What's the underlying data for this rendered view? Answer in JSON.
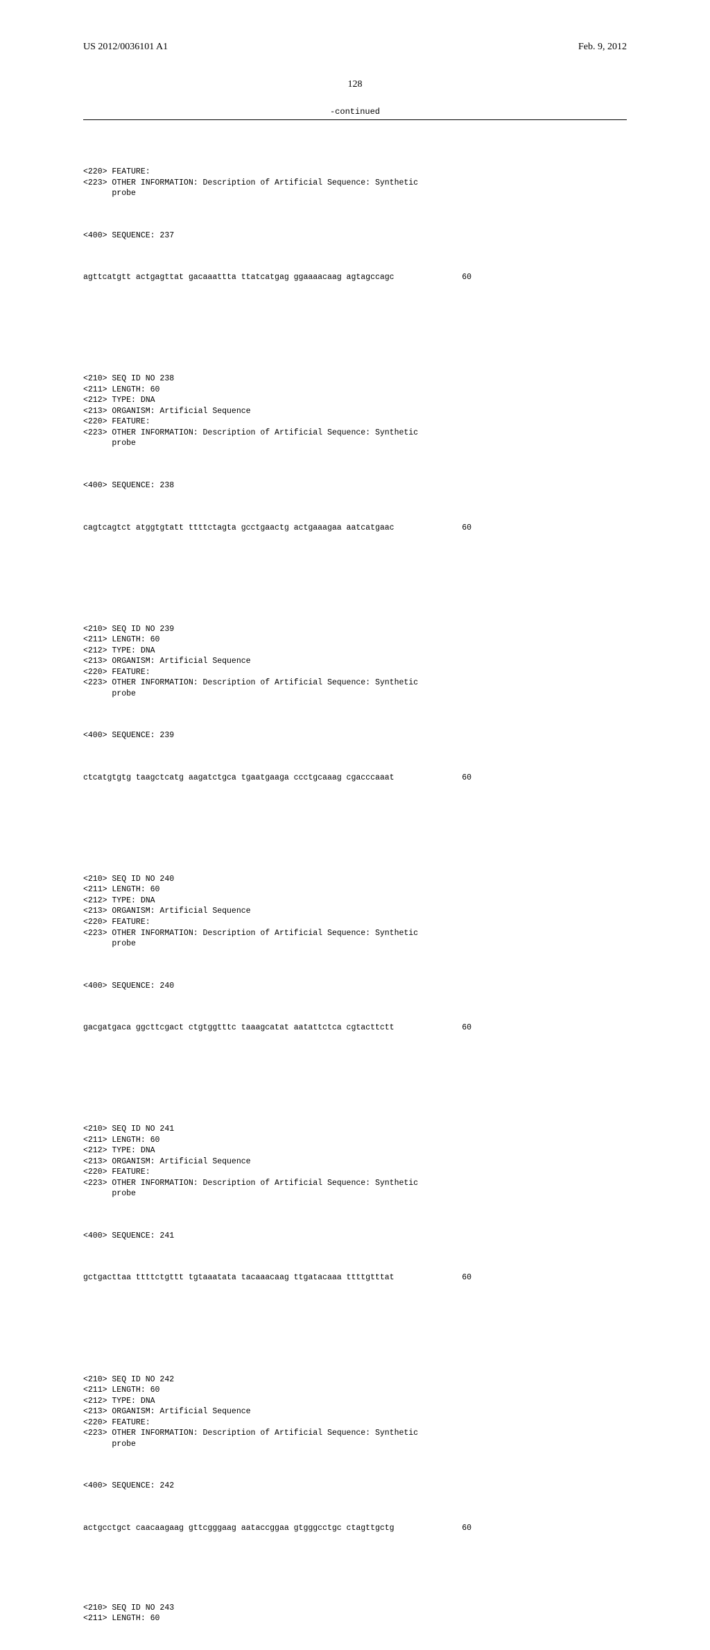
{
  "header": {
    "pub_number": "US 2012/0036101 A1",
    "pub_date": "Feb. 9, 2012"
  },
  "page_number": "128",
  "continued_label": "-continued",
  "first_entry": {
    "l220": "<220> FEATURE:",
    "l223a": "<223> OTHER INFORMATION: Description of Artificial Sequence: Synthetic",
    "l223b": "      probe",
    "l400": "<400> SEQUENCE: 237",
    "seq": "agttcatgtt actgagttat gacaaattta ttatcatgag ggaaaacaag agtagccagc",
    "pos": "60"
  },
  "entries": [
    {
      "l210": "<210> SEQ ID NO 238",
      "l211": "<211> LENGTH: 60",
      "l212": "<212> TYPE: DNA",
      "l213": "<213> ORGANISM: Artificial Sequence",
      "l220": "<220> FEATURE:",
      "l223a": "<223> OTHER INFORMATION: Description of Artificial Sequence: Synthetic",
      "l223b": "      probe",
      "l400": "<400> SEQUENCE: 238",
      "seq": "cagtcagtct atggtgtatt ttttctagta gcctgaactg actgaaagaa aatcatgaac",
      "pos": "60"
    },
    {
      "l210": "<210> SEQ ID NO 239",
      "l211": "<211> LENGTH: 60",
      "l212": "<212> TYPE: DNA",
      "l213": "<213> ORGANISM: Artificial Sequence",
      "l220": "<220> FEATURE:",
      "l223a": "<223> OTHER INFORMATION: Description of Artificial Sequence: Synthetic",
      "l223b": "      probe",
      "l400": "<400> SEQUENCE: 239",
      "seq": "ctcatgtgtg taagctcatg aagatctgca tgaatgaaga ccctgcaaag cgacccaaat",
      "pos": "60"
    },
    {
      "l210": "<210> SEQ ID NO 240",
      "l211": "<211> LENGTH: 60",
      "l212": "<212> TYPE: DNA",
      "l213": "<213> ORGANISM: Artificial Sequence",
      "l220": "<220> FEATURE:",
      "l223a": "<223> OTHER INFORMATION: Description of Artificial Sequence: Synthetic",
      "l223b": "      probe",
      "l400": "<400> SEQUENCE: 240",
      "seq": "gacgatgaca ggcttcgact ctgtggtttc taaagcatat aatattctca cgtacttctt",
      "pos": "60"
    },
    {
      "l210": "<210> SEQ ID NO 241",
      "l211": "<211> LENGTH: 60",
      "l212": "<212> TYPE: DNA",
      "l213": "<213> ORGANISM: Artificial Sequence",
      "l220": "<220> FEATURE:",
      "l223a": "<223> OTHER INFORMATION: Description of Artificial Sequence: Synthetic",
      "l223b": "      probe",
      "l400": "<400> SEQUENCE: 241",
      "seq": "gctgacttaa ttttctgttt tgtaaatata tacaaacaag ttgatacaaa ttttgtttat",
      "pos": "60"
    },
    {
      "l210": "<210> SEQ ID NO 242",
      "l211": "<211> LENGTH: 60",
      "l212": "<212> TYPE: DNA",
      "l213": "<213> ORGANISM: Artificial Sequence",
      "l220": "<220> FEATURE:",
      "l223a": "<223> OTHER INFORMATION: Description of Artificial Sequence: Synthetic",
      "l223b": "      probe",
      "l400": "<400> SEQUENCE: 242",
      "seq": "actgcctgct caacaagaag gttcgggaag aataccggaa gtgggcctgc ctagttgctg",
      "pos": "60"
    }
  ],
  "trailing": {
    "l210": "<210> SEQ ID NO 243",
    "l211": "<211> LENGTH: 60"
  }
}
